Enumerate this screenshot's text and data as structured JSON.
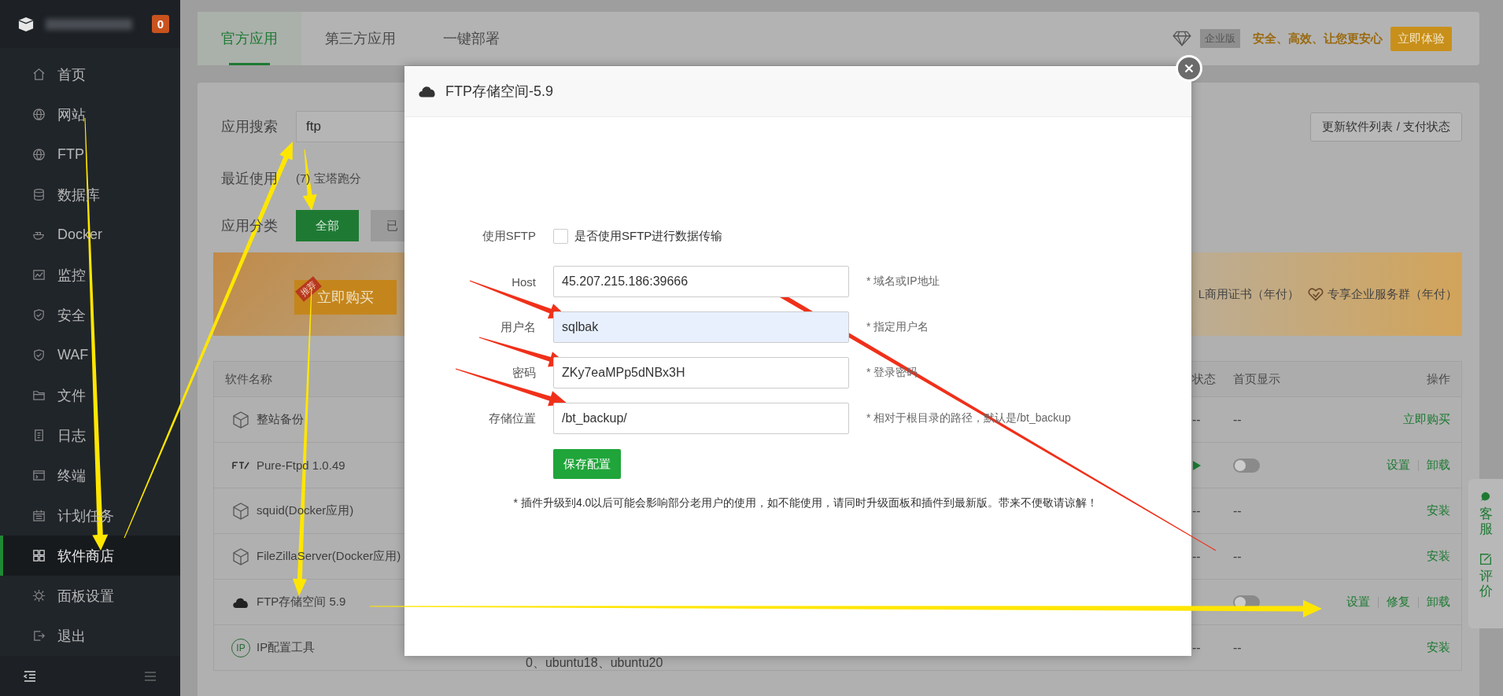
{
  "sidebar": {
    "badge": "0",
    "items": [
      {
        "label": "首页",
        "kind": "home",
        "selected": false
      },
      {
        "label": "网站",
        "kind": "globe",
        "selected": false
      },
      {
        "label": "FTP",
        "kind": "globe",
        "selected": false
      },
      {
        "label": "数据库",
        "kind": "database",
        "selected": false
      },
      {
        "label": "Docker",
        "kind": "docker",
        "selected": false
      },
      {
        "label": "监控",
        "kind": "monitor",
        "selected": false
      },
      {
        "label": "安全",
        "kind": "shield",
        "selected": false
      },
      {
        "label": "WAF",
        "kind": "shield",
        "selected": false
      },
      {
        "label": "文件",
        "kind": "folder",
        "selected": false
      },
      {
        "label": "日志",
        "kind": "log",
        "selected": false
      },
      {
        "label": "终端",
        "kind": "terminal",
        "selected": false
      },
      {
        "label": "计划任务",
        "kind": "calendar",
        "selected": false
      },
      {
        "label": "软件商店",
        "kind": "grid",
        "selected": true
      },
      {
        "label": "面板设置",
        "kind": "gear",
        "selected": false
      },
      {
        "label": "退出",
        "kind": "logout",
        "selected": false
      }
    ]
  },
  "tabs": [
    {
      "label": "官方应用",
      "selected": true
    },
    {
      "label": "第三方应用",
      "selected": false
    },
    {
      "label": "一键部署",
      "selected": false
    }
  ],
  "promo": {
    "badge": "企业版",
    "slogan": "安全、高效、让您更安心",
    "button": "立即体验"
  },
  "search": {
    "label": "应用搜索",
    "value": "ftp"
  },
  "update_button": "更新软件列表 / 支付状态",
  "recent": {
    "label": "最近使用",
    "items": [
      {
        "icon_text": "(7)",
        "label": "宝塔跑分"
      }
    ]
  },
  "category": {
    "label": "应用分类",
    "options": [
      {
        "label": "全部",
        "selected": true
      },
      {
        "label": "已",
        "selected": false
      }
    ]
  },
  "banner": {
    "ribbon": "推荐",
    "button": "立即购买",
    "offers": [
      {
        "label": "L商用证书（年付）",
        "kind": "plain"
      },
      {
        "label": "专享企业服务群（年付）",
        "kind": "heart"
      }
    ]
  },
  "table": {
    "columns": [
      "软件名称",
      "状态",
      "首页显示",
      "操作"
    ],
    "rows": [
      {
        "kind": "box",
        "name": "整站备份",
        "status": "--",
        "home": "--",
        "actions": [
          "立即购买"
        ]
      },
      {
        "kind": "pureftp",
        "name": "Pure-Ftpd 1.0.49",
        "running": true,
        "switch_on": false,
        "actions": [
          "设置",
          "卸载"
        ]
      },
      {
        "kind": "box",
        "name": "squid(Docker应用)",
        "status": "--",
        "home": "--",
        "actions": [
          "安装"
        ]
      },
      {
        "kind": "box",
        "name": "FileZillaServer(Docker应用)",
        "status": "--",
        "home": "--",
        "actions": [
          "安装"
        ]
      },
      {
        "kind": "cloud",
        "name": "FTP存储空间 5.9",
        "switch_on": false,
        "actions": [
          "设置",
          "修复",
          "卸载"
        ]
      },
      {
        "kind": "ip",
        "icon_text": "IP",
        "name": "IP配置工具",
        "detail": "0、ubuntu18、ubuntu20",
        "status": "--",
        "home": "--",
        "actions": [
          "安装"
        ]
      }
    ]
  },
  "modal": {
    "title": "FTP存储空间-5.9",
    "sftp": {
      "label": "使用SFTP",
      "text": "是否使用SFTP进行数据传输",
      "checked": false
    },
    "fields": [
      {
        "label": "Host",
        "value": "45.207.215.186:39666",
        "hint": "* 域名或IP地址",
        "focused": false
      },
      {
        "label": "用户名",
        "value": "sqlbak",
        "hint": "* 指定用户名",
        "focused": true
      },
      {
        "label": "密码",
        "value": "ZKy7eaMPp5dNBx3H",
        "hint": "* 登录密码",
        "focused": false
      },
      {
        "label": "存储位置",
        "value": "/bt_backup/",
        "hint": "* 相对于根目录的路径，默认是/bt_backup",
        "focused": false
      }
    ],
    "save": "保存配置",
    "note": "* 插件升级到4.0以后可能会影响部分老用户的使用，如不能使用，请同时升级面板和插件到最新版。带来不便敬请谅解！"
  },
  "side_widget": [
    {
      "kind": "chat",
      "label": "客服"
    },
    {
      "kind": "edit",
      "label": "评价"
    }
  ]
}
